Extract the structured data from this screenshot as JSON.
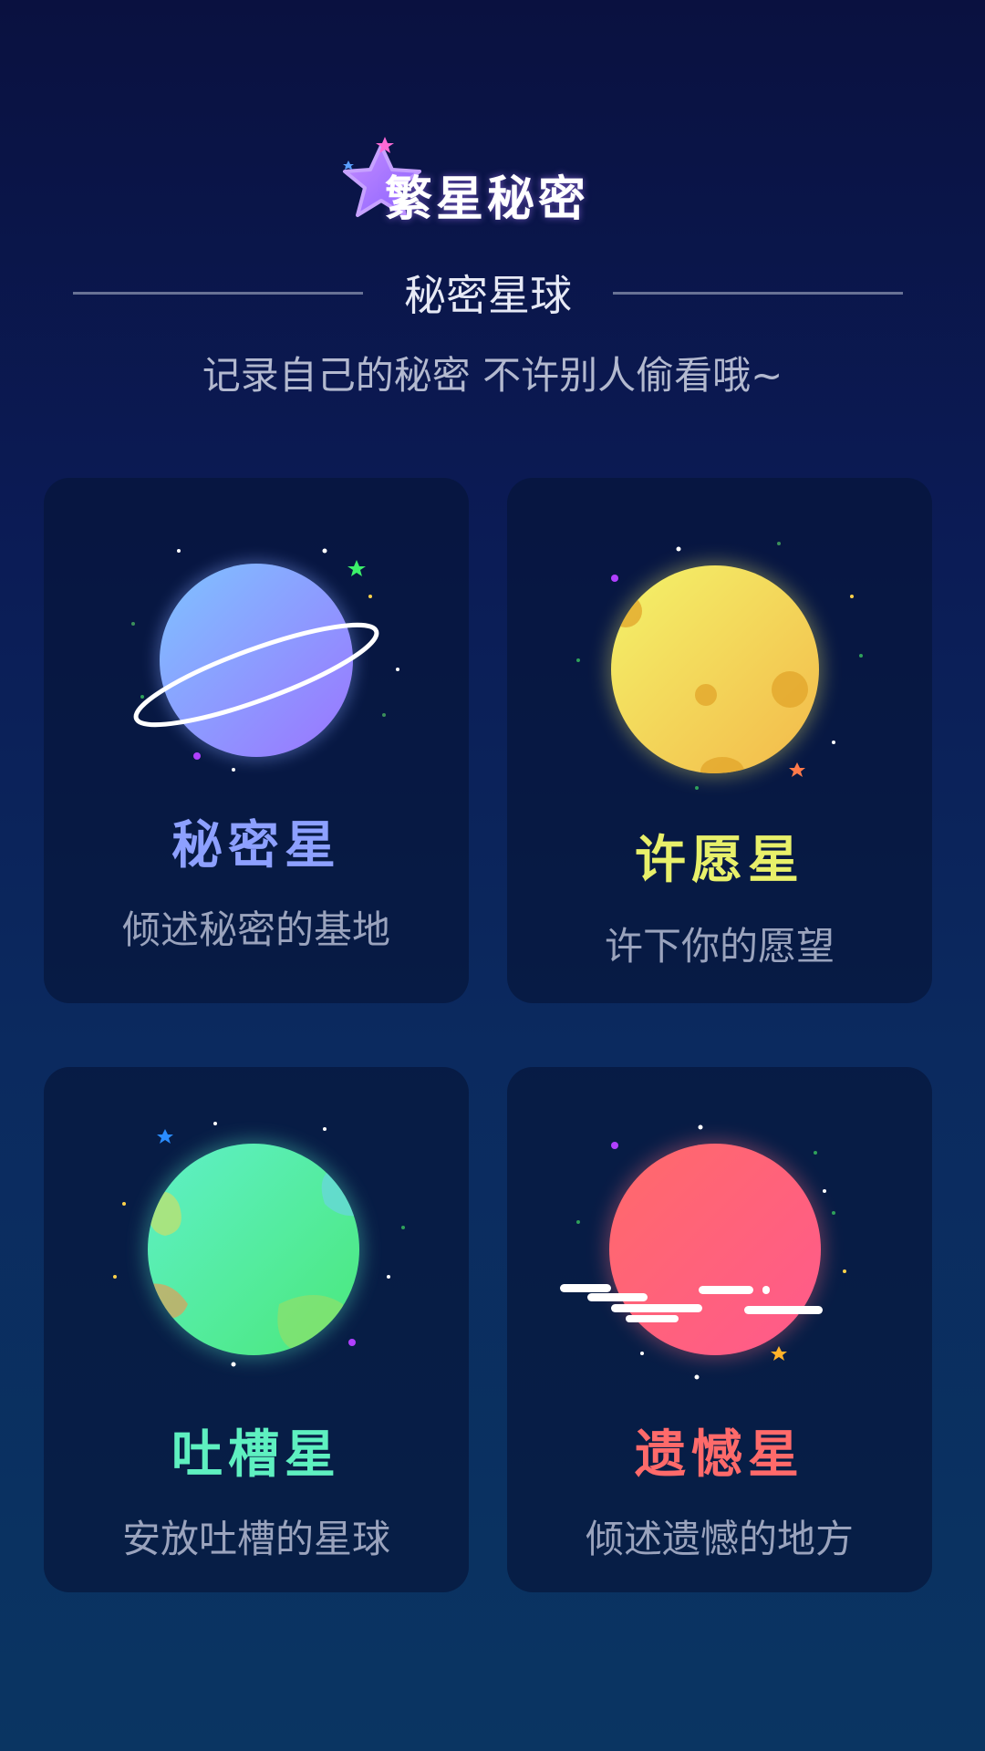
{
  "header": {
    "logo_text": "繁星秘密",
    "subtitle": "秘密星球",
    "tagline": "记录自己的秘密 不许别人偷看哦~"
  },
  "cards": [
    {
      "title": "秘密星",
      "desc": "倾述秘密的基地",
      "title_color": "#8da0ff",
      "icon": "ringed-planet-icon"
    },
    {
      "title": "许愿星",
      "desc": "许下你的愿望",
      "title_color": "#e8f06a",
      "icon": "moon-planet-icon"
    },
    {
      "title": "吐槽星",
      "desc": "安放吐槽的星球",
      "title_color": "#5ef0c0",
      "icon": "green-planet-icon"
    },
    {
      "title": "遗憾星",
      "desc": "倾述遗憾的地方",
      "title_color": "#ff6a6a",
      "icon": "red-planet-icon"
    }
  ],
  "colors": {
    "background_top": "#0a1140",
    "background_bottom": "#0a3562"
  }
}
